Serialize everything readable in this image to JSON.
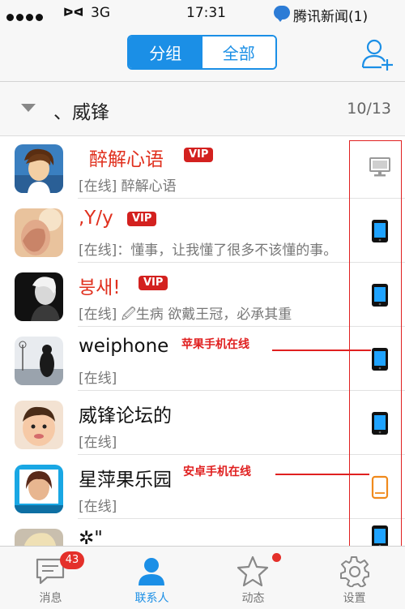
{
  "status_bar": {
    "carrier_glyph": "ᐅᐊ",
    "network": "3G",
    "time": "17:31",
    "notification": "腾讯新闻(1)"
  },
  "segmented": {
    "left": "分组",
    "right": "全部",
    "selected": "分组"
  },
  "group": {
    "name": "、威锋",
    "count": "10/13"
  },
  "contacts": [
    {
      "name": "醉解心语",
      "vip": "VIP",
      "status": "[在线] 醉解心语",
      "device": "computer"
    },
    {
      "name": ",Y/y",
      "vip": "VIP",
      "status": "[在线]：懂事，让我懂了很多不该懂的事。",
      "device": "phone"
    },
    {
      "name": "붕새!",
      "vip": "VIP",
      "status": "[在线] 🖉生病 欲戴王冠，必承其重",
      "device": "phone"
    },
    {
      "name": "weiphone",
      "vip": "",
      "status": "[在线]",
      "device": "phone"
    },
    {
      "name": "威锋论坛的",
      "vip": "",
      "status": "[在线]",
      "device": "phone"
    },
    {
      "name": "星萍果乐园",
      "vip": "",
      "status": "[在线]",
      "device": "android"
    },
    {
      "name": "✲\"",
      "vip": "",
      "status": "",
      "device": "phone"
    }
  ],
  "annotations": {
    "apple": "苹果手机在线",
    "android": "安卓手机在线"
  },
  "tabs": [
    {
      "label": "消息",
      "icon": "message-icon",
      "badge": "43"
    },
    {
      "label": "联系人",
      "icon": "contacts-icon",
      "badge": ""
    },
    {
      "label": "动态",
      "icon": "star-icon",
      "badge": ""
    },
    {
      "label": "设置",
      "icon": "gear-icon",
      "badge": ""
    }
  ],
  "colors": {
    "accent": "#1b8fe6",
    "vip": "#d3211f",
    "annotation": "#e02020"
  }
}
